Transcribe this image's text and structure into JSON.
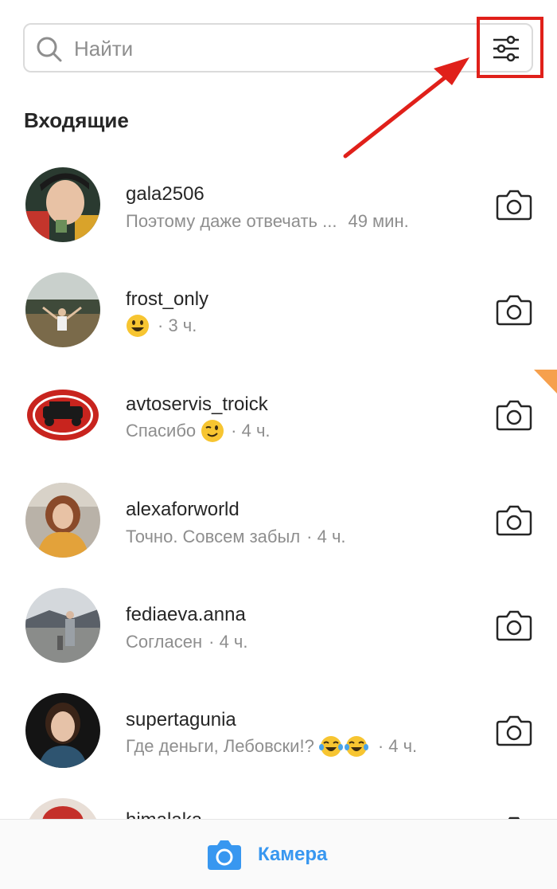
{
  "search": {
    "placeholder": "Найти"
  },
  "section_title": "Входящие",
  "threads": [
    {
      "username": "gala2506",
      "preview": "Поэтому даже отвечать ...",
      "time": "49 мин.",
      "emojis": []
    },
    {
      "username": "frost_only",
      "preview": "",
      "time": "· 3 ч.",
      "emojis": [
        "grinning"
      ]
    },
    {
      "username": "avtoservis_troick",
      "preview": "Спасибо",
      "time": "· 4 ч.",
      "emojis": [
        "winking"
      ]
    },
    {
      "username": "alexaforworld",
      "preview": "Точно. Совсем забыл",
      "time": "· 4 ч.",
      "emojis": []
    },
    {
      "username": "fediaeva.anna",
      "preview": "Согласен",
      "time": "· 4 ч.",
      "emojis": []
    },
    {
      "username": "supertagunia",
      "preview": "Где деньги, Лебовски!?",
      "time": "· 4 ч.",
      "emojis": [
        "tears-of-joy",
        "tears-of-joy"
      ]
    },
    {
      "username": "himalaka",
      "preview": "",
      "time": "",
      "emojis": []
    }
  ],
  "bottom_bar": {
    "camera_label": "Камера"
  },
  "colors": {
    "accent": "#3897f0",
    "annotation_red": "#e0201a",
    "secondary_text": "#8e8e8e",
    "orange_tab": "#f6a04d"
  }
}
